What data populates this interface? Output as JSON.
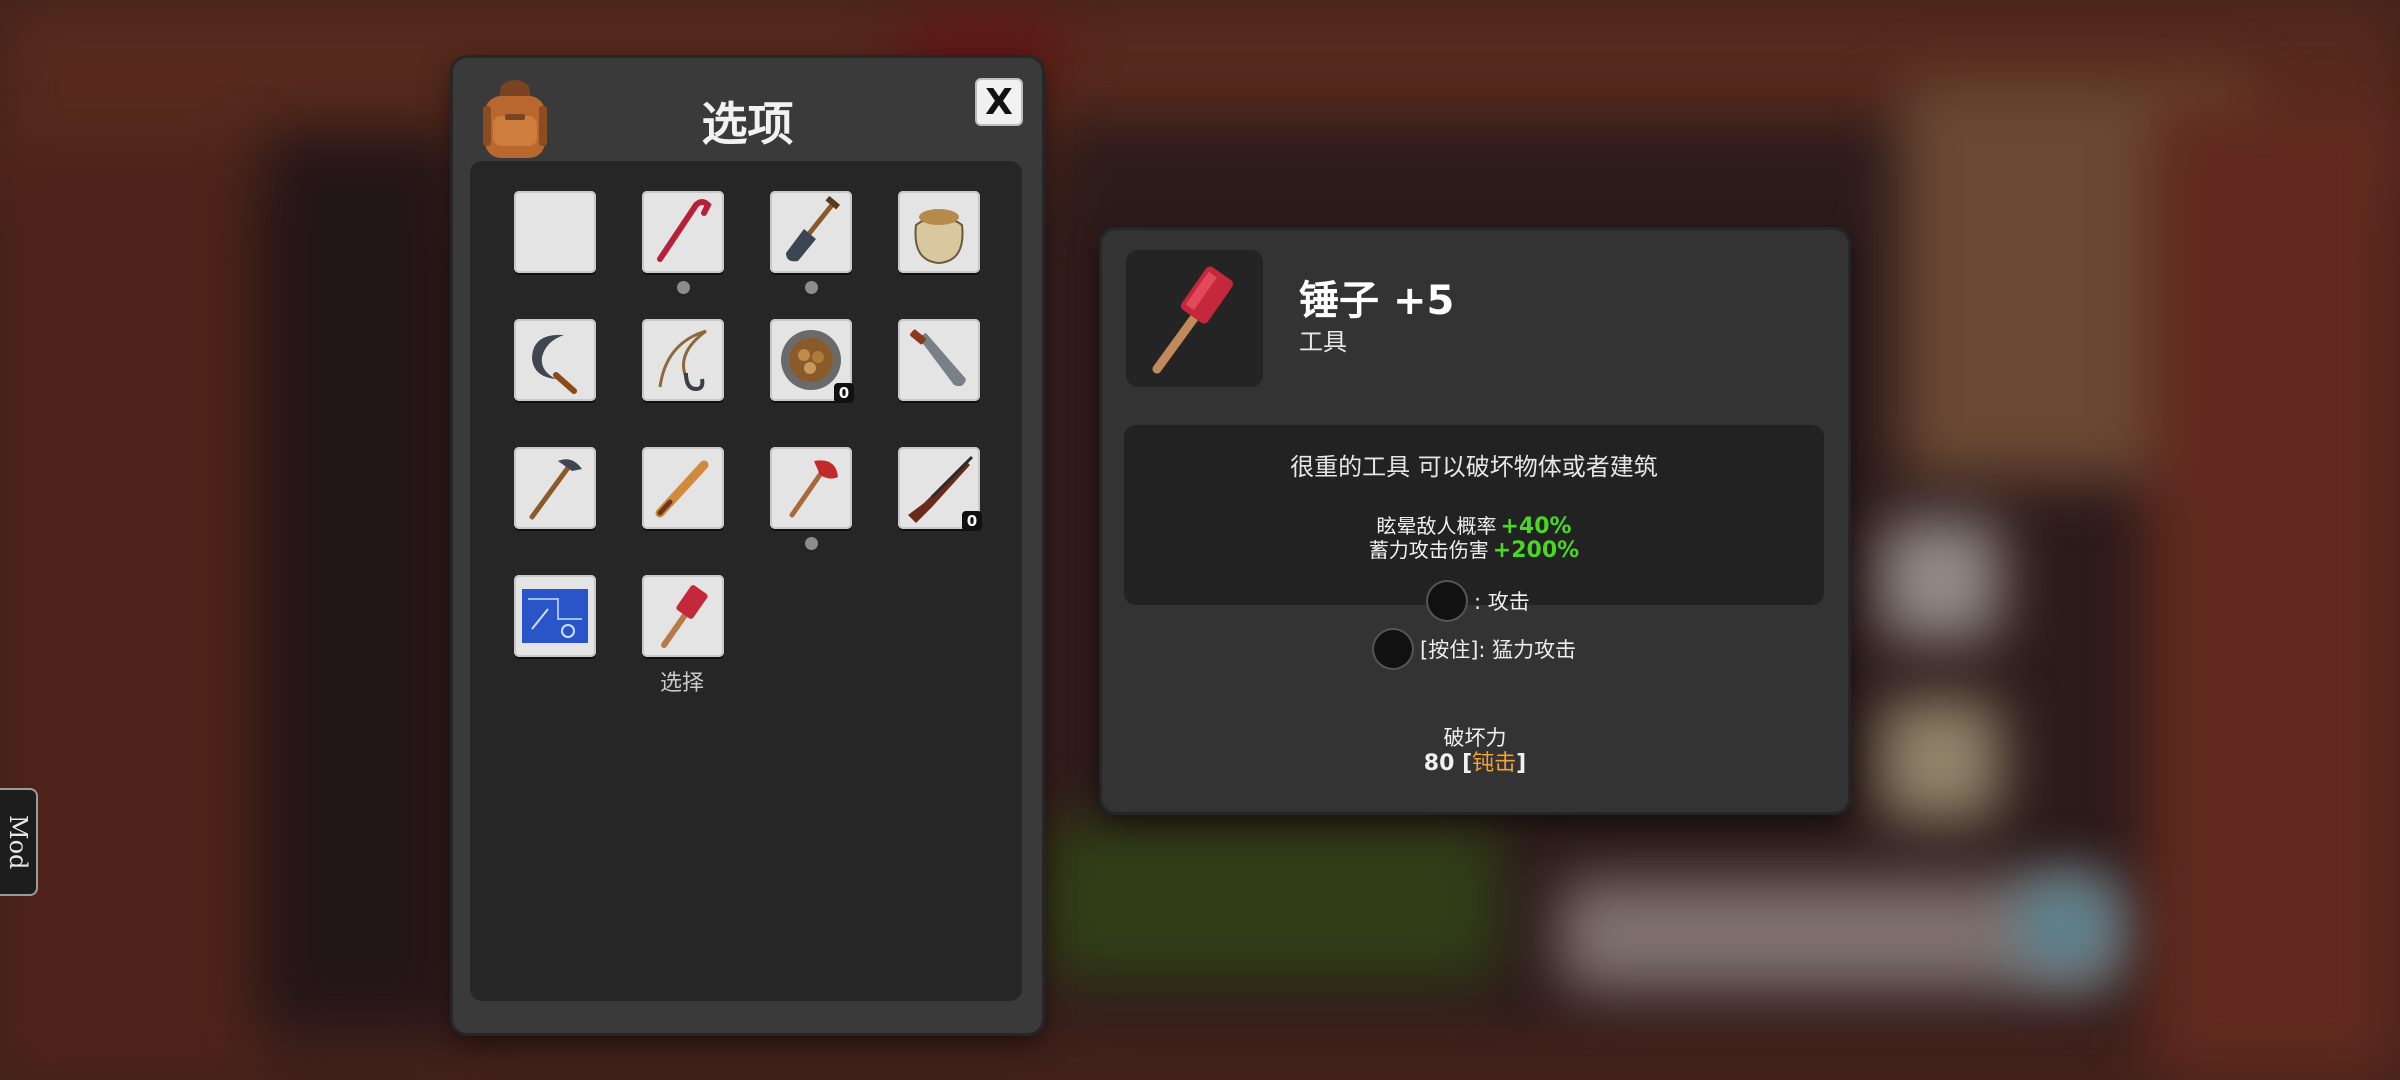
{
  "inventory": {
    "title": "选项",
    "close_label": "X",
    "select_label": "选择",
    "slots": [
      {
        "name": "empty-slot",
        "icon": "empty"
      },
      {
        "name": "crowbar",
        "icon": "crowbar-icon"
      },
      {
        "name": "shovel",
        "icon": "shovel-icon"
      },
      {
        "name": "sack",
        "icon": "sack-icon"
      },
      {
        "name": "sickle",
        "icon": "sickle-icon"
      },
      {
        "name": "rope-hook",
        "icon": "rope-hook-icon"
      },
      {
        "name": "food-bowl",
        "icon": "food-bowl-icon",
        "count": "0"
      },
      {
        "name": "machete",
        "icon": "machete-icon"
      },
      {
        "name": "pickaxe",
        "icon": "pickaxe-icon"
      },
      {
        "name": "baseball-bat",
        "icon": "bat-icon"
      },
      {
        "name": "fire-axe",
        "icon": "axe-icon"
      },
      {
        "name": "rifle",
        "icon": "rifle-icon",
        "count": "0"
      },
      {
        "name": "blueprint",
        "icon": "blueprint-icon"
      },
      {
        "name": "sledgehammer",
        "icon": "hammer-icon"
      }
    ]
  },
  "detail": {
    "name": "锤子",
    "level": "+5",
    "type": "工具",
    "description": "很重的工具 可以破坏物体或者建筑",
    "stats": [
      {
        "label": "眩晕敌人概率",
        "value": "+40%"
      },
      {
        "label": "蓄力攻击伤害",
        "value": "+200%"
      }
    ],
    "controls": [
      {
        "label": ": 攻击"
      },
      {
        "label": "[按住]: 猛力攻击"
      }
    ],
    "damage_label": "破坏力",
    "damage_value": "80",
    "damage_type": "钝击"
  },
  "mod_tab": "Mod",
  "colors": {
    "stat_green": "#4bd624",
    "damage_type_orange": "#f2a23a"
  }
}
